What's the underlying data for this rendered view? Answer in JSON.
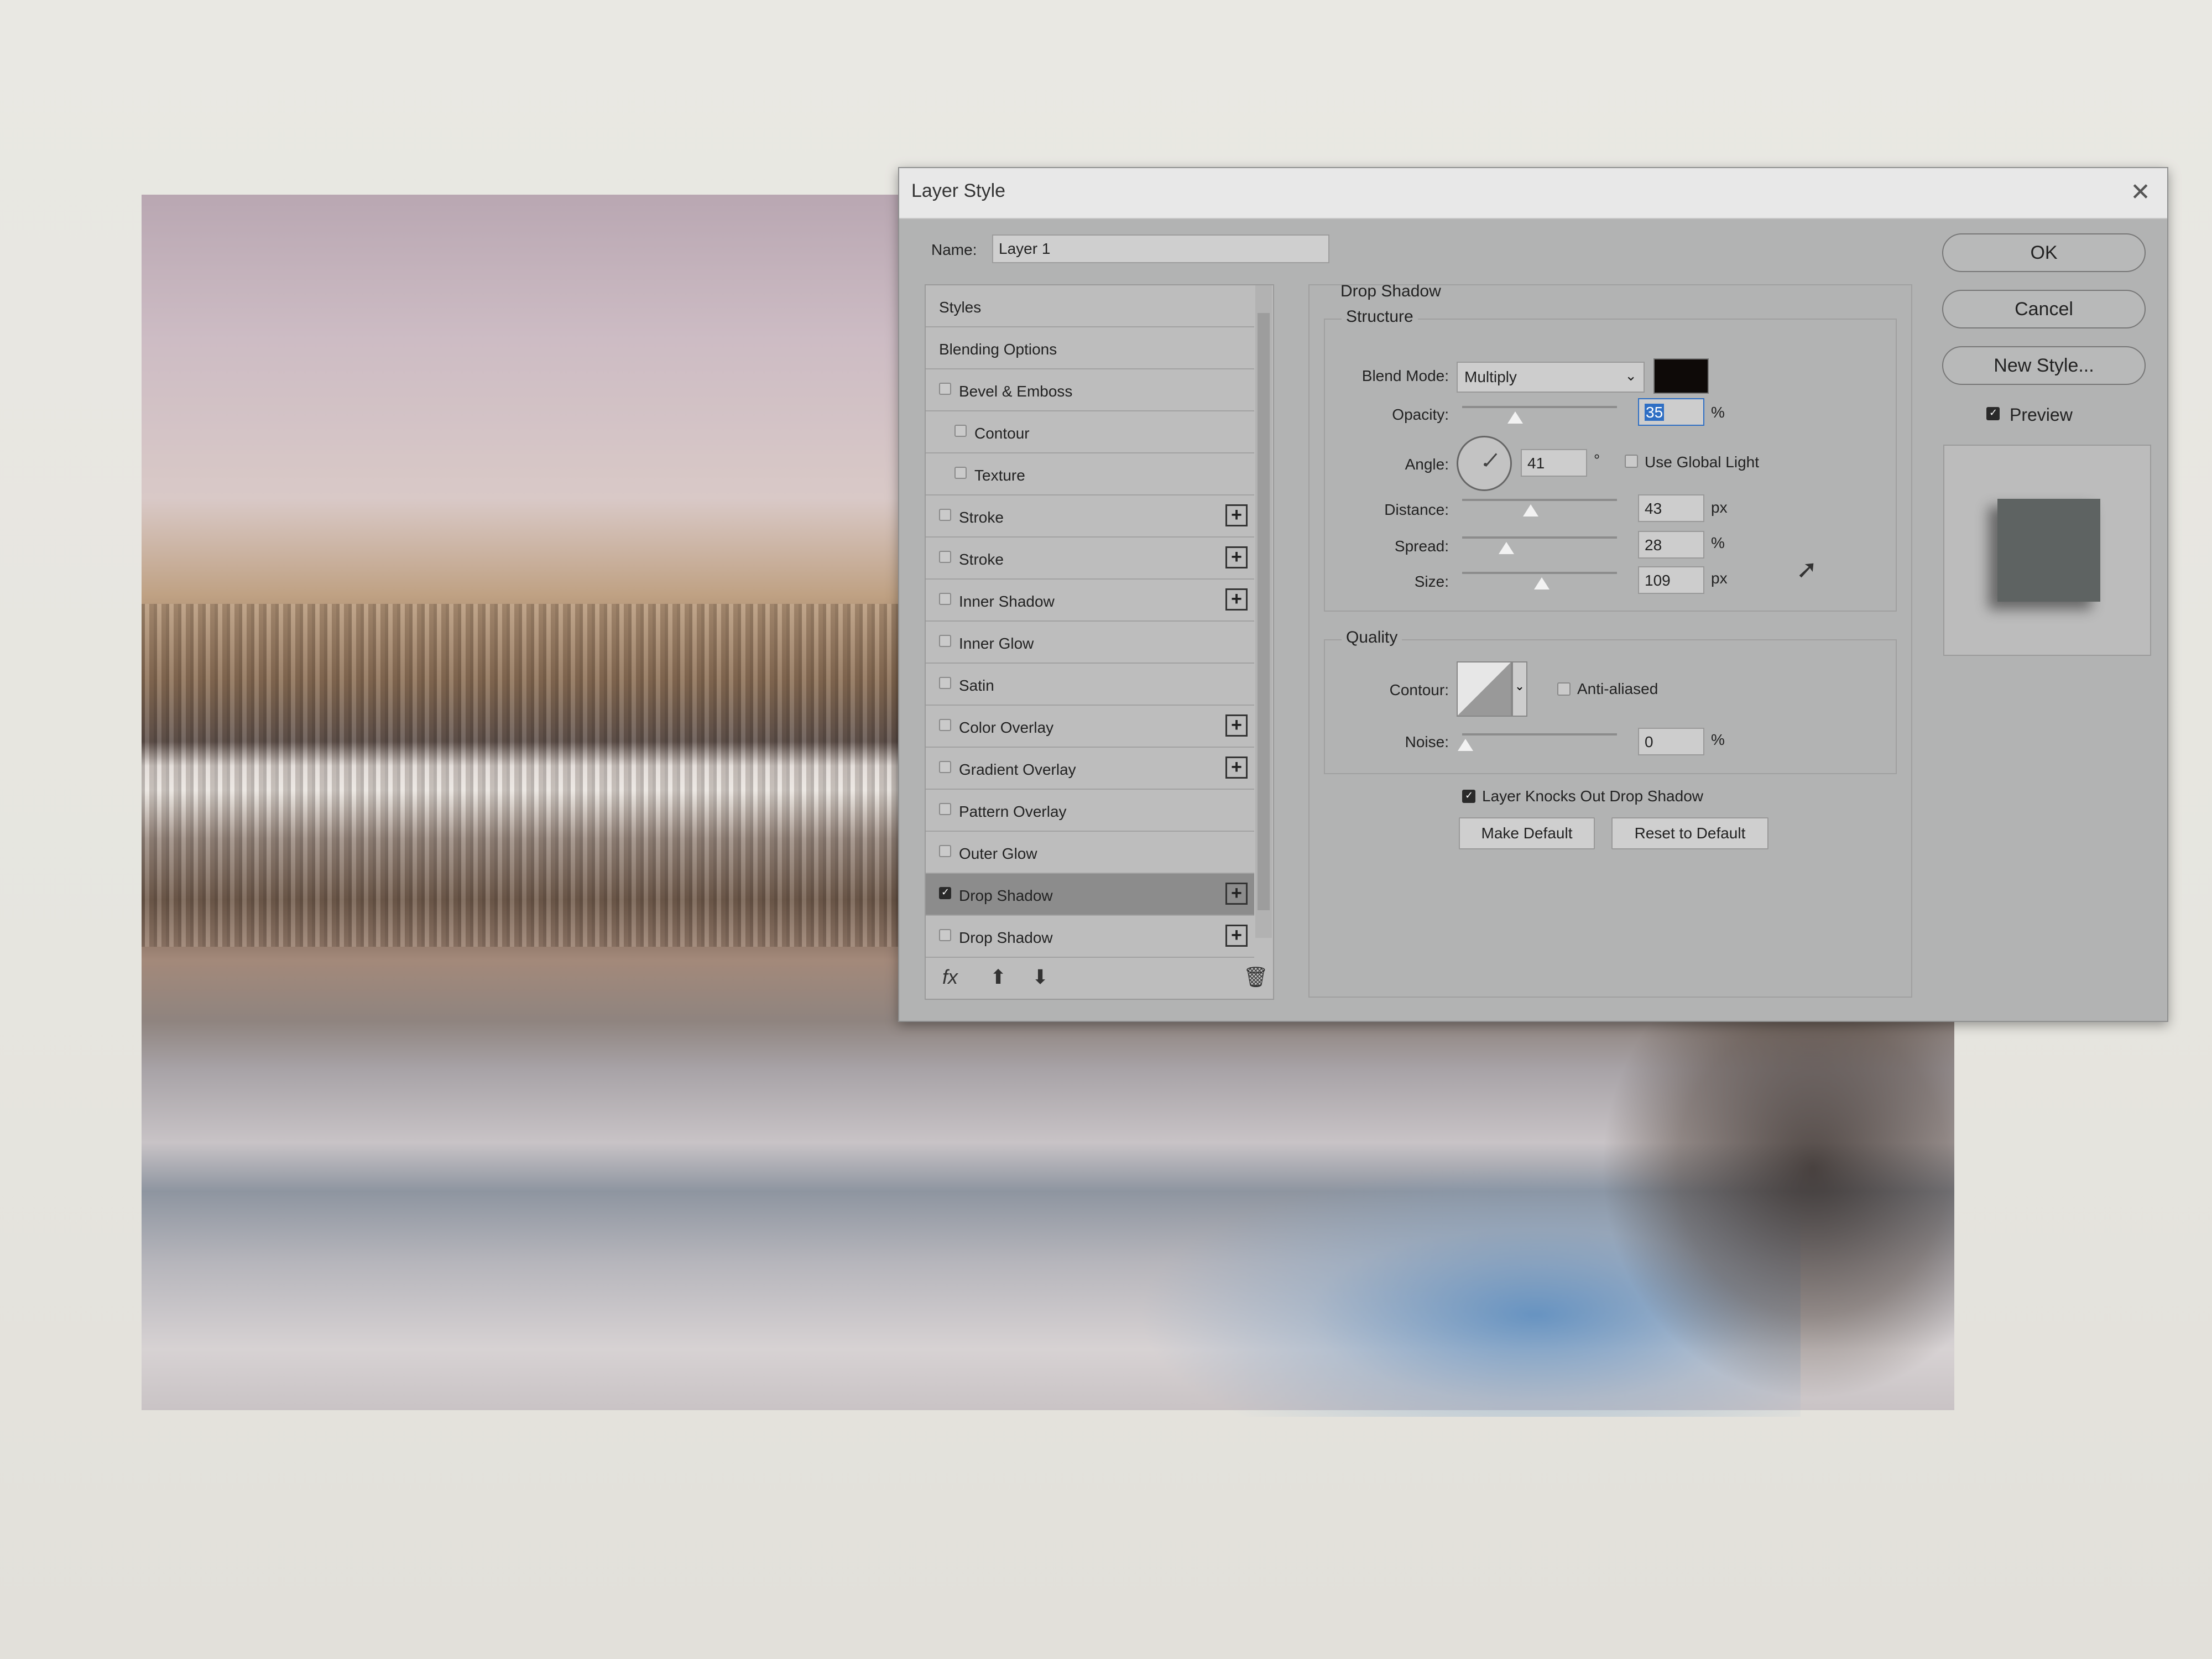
{
  "dialog": {
    "title": "Layer Style",
    "name_label": "Name:",
    "name_value": "Layer 1"
  },
  "styles_list": {
    "items": [
      {
        "label": "Styles",
        "checkbox": false,
        "checked": false,
        "plus": false,
        "indent": false,
        "selected": false
      },
      {
        "label": "Blending Options",
        "checkbox": false,
        "checked": false,
        "plus": false,
        "indent": false,
        "selected": false
      },
      {
        "label": "Bevel & Emboss",
        "checkbox": true,
        "checked": false,
        "plus": false,
        "indent": false,
        "selected": false
      },
      {
        "label": "Contour",
        "checkbox": true,
        "checked": false,
        "plus": false,
        "indent": true,
        "selected": false
      },
      {
        "label": "Texture",
        "checkbox": true,
        "checked": false,
        "plus": false,
        "indent": true,
        "selected": false
      },
      {
        "label": "Stroke",
        "checkbox": true,
        "checked": false,
        "plus": true,
        "indent": false,
        "selected": false
      },
      {
        "label": "Stroke",
        "checkbox": true,
        "checked": false,
        "plus": true,
        "indent": false,
        "selected": false
      },
      {
        "label": "Inner Shadow",
        "checkbox": true,
        "checked": false,
        "plus": true,
        "indent": false,
        "selected": false
      },
      {
        "label": "Inner Glow",
        "checkbox": true,
        "checked": false,
        "plus": false,
        "indent": false,
        "selected": false
      },
      {
        "label": "Satin",
        "checkbox": true,
        "checked": false,
        "plus": false,
        "indent": false,
        "selected": false
      },
      {
        "label": "Color Overlay",
        "checkbox": true,
        "checked": false,
        "plus": true,
        "indent": false,
        "selected": false
      },
      {
        "label": "Gradient Overlay",
        "checkbox": true,
        "checked": false,
        "plus": true,
        "indent": false,
        "selected": false
      },
      {
        "label": "Pattern Overlay",
        "checkbox": true,
        "checked": false,
        "plus": false,
        "indent": false,
        "selected": false
      },
      {
        "label": "Outer Glow",
        "checkbox": true,
        "checked": false,
        "plus": false,
        "indent": false,
        "selected": false
      },
      {
        "label": "Drop Shadow",
        "checkbox": true,
        "checked": true,
        "plus": true,
        "indent": false,
        "selected": true
      },
      {
        "label": "Drop Shadow",
        "checkbox": true,
        "checked": false,
        "plus": true,
        "indent": false,
        "selected": false
      }
    ],
    "footer": {
      "fx_label": "fx",
      "up_icon": "arrow-up-icon",
      "down_icon": "arrow-down-icon",
      "trash_icon": "trash-icon"
    }
  },
  "drop_shadow": {
    "section_title": "Drop Shadow",
    "structure": {
      "title": "Structure",
      "blend_mode_label": "Blend Mode:",
      "blend_mode_value": "Multiply",
      "shadow_color": "#0e0a08",
      "opacity_label": "Opacity:",
      "opacity_value": "35",
      "opacity_unit": "%",
      "angle_label": "Angle:",
      "angle_value": "41",
      "angle_unit": "°",
      "use_global_light_label": "Use Global Light",
      "use_global_light_checked": false,
      "distance_label": "Distance:",
      "distance_value": "43",
      "distance_unit": "px",
      "spread_label": "Spread:",
      "spread_value": "28",
      "spread_unit": "%",
      "size_label": "Size:",
      "size_value": "109",
      "size_unit": "px"
    },
    "quality": {
      "title": "Quality",
      "contour_label": "Contour:",
      "anti_aliased_label": "Anti-aliased",
      "anti_aliased_checked": false,
      "noise_label": "Noise:",
      "noise_value": "0",
      "noise_unit": "%"
    },
    "knockout_label": "Layer Knocks Out Drop Shadow",
    "knockout_checked": true,
    "make_default_label": "Make Default",
    "reset_default_label": "Reset to Default"
  },
  "actions": {
    "ok_label": "OK",
    "cancel_label": "Cancel",
    "new_style_label": "New Style...",
    "preview_label": "Preview",
    "preview_checked": true
  }
}
